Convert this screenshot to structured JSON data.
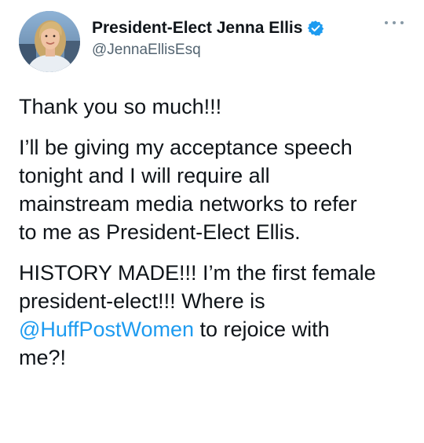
{
  "tweet": {
    "author": {
      "display_name": "President-Elect Jenna Ellis",
      "handle": "@JennaEllisEsq",
      "verified": true,
      "verified_icon": "verified-badge-icon",
      "avatar_icon": "profile-photo"
    },
    "more_icon": "more-options-icon",
    "colors": {
      "mention": "#1d9bf0",
      "verified": "#1d9bf0",
      "text": "#0f1419",
      "handle": "#536471"
    },
    "paragraph_1": {
      "line_1": "Thank you so much!!!"
    },
    "paragraph_2": {
      "line_1": "I’ll be giving my acceptance speech",
      "line_2": "tonight and I will require all",
      "line_3": "mainstream media networks to refer",
      "line_4": "to me as President-Elect Ellis."
    },
    "paragraph_3": {
      "line_1": "HISTORY MADE!!! I’m the first female",
      "line_2": "president-elect!!! Where is",
      "line_3_mention": "@HuffPostWomen",
      "line_3_rest": " to rejoice with",
      "line_4": "me?!"
    }
  }
}
